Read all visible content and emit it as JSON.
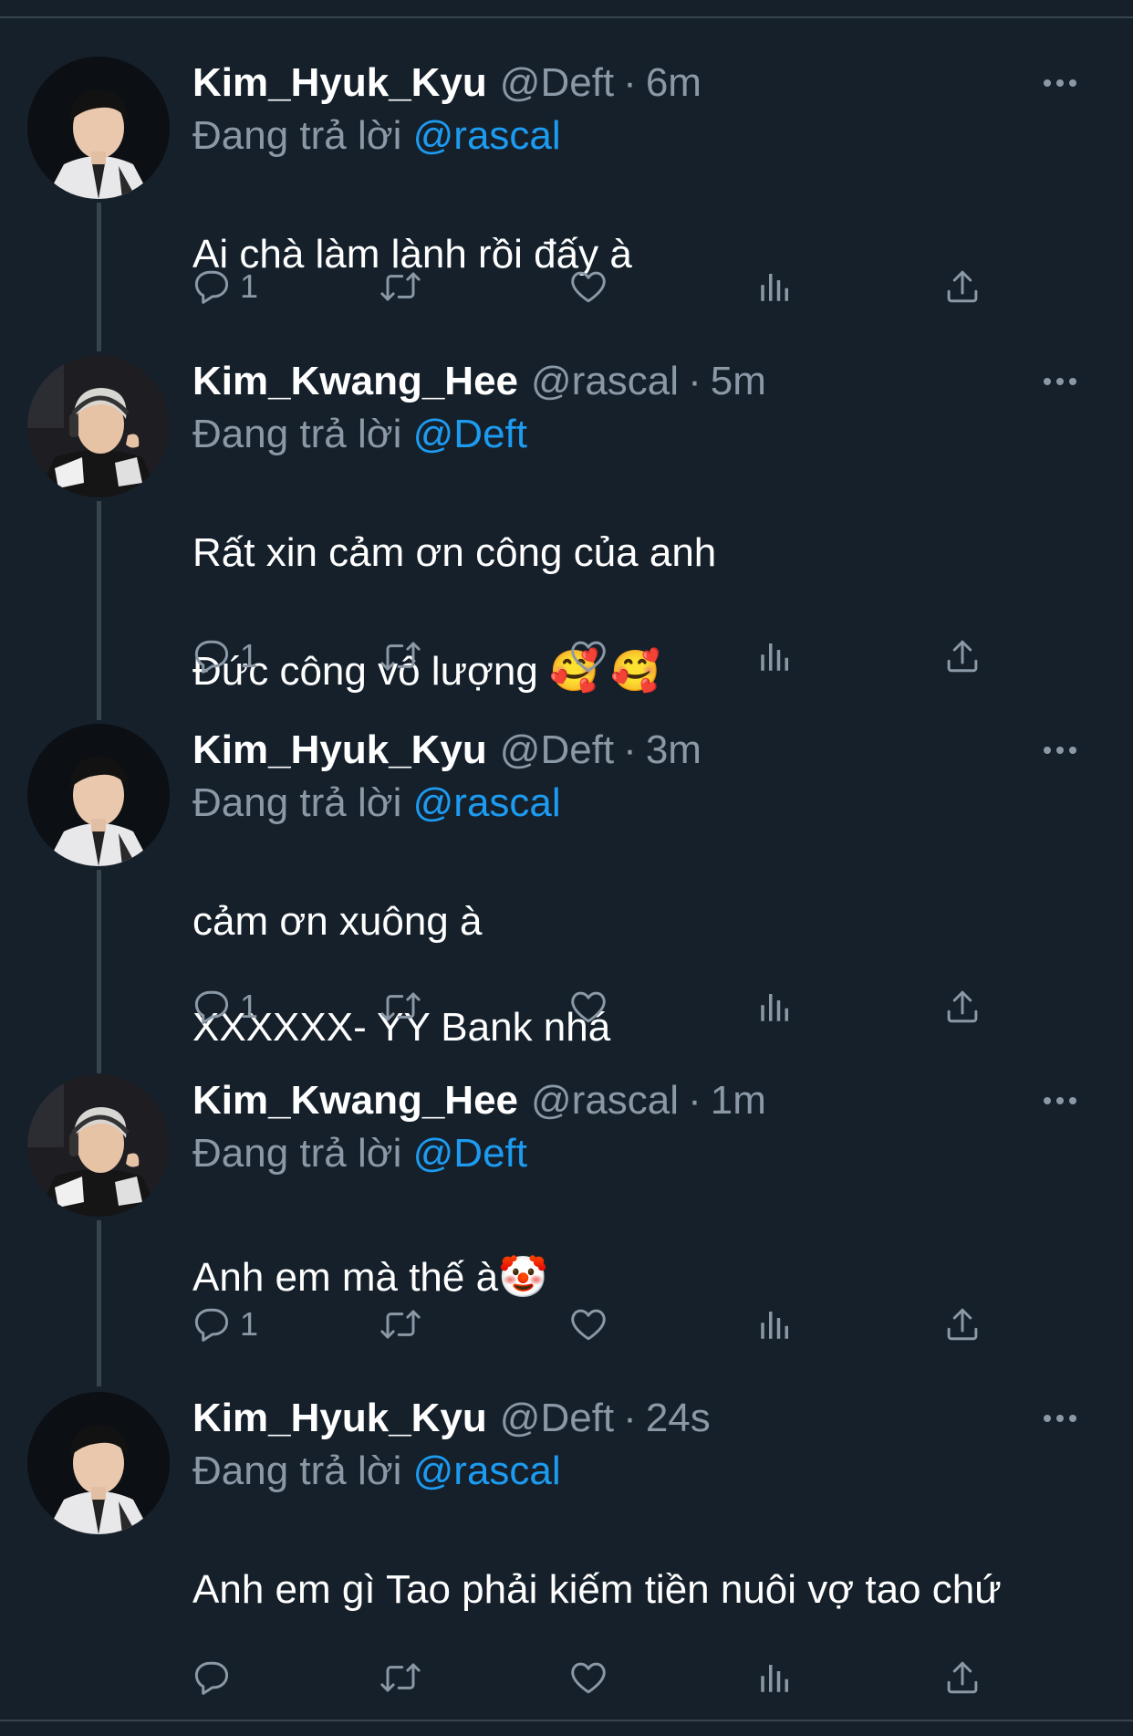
{
  "tweets": [
    {
      "name": "Kim_Hyuk_Kyu",
      "handle": "@Deft",
      "time": "6m",
      "reply_prefix": "Đang trả lời",
      "reply_to": "@rascal",
      "lines": [
        "Ai chà làm lành rồi đấy à"
      ],
      "reply_count": "1",
      "avatar": "avatar-deft"
    },
    {
      "name": "Kim_Kwang_Hee",
      "handle": "@rascal",
      "time": "5m",
      "reply_prefix": "Đang trả lời",
      "reply_to": "@Deft",
      "lines": [
        "Rất xin cảm ơn công của anh",
        "Đức công vô lượng 🥰 🥰"
      ],
      "reply_count": "1",
      "avatar": "avatar-rascal"
    },
    {
      "name": "Kim_Hyuk_Kyu",
      "handle": "@Deft",
      "time": "3m",
      "reply_prefix": "Đang trả lời",
      "reply_to": "@rascal",
      "lines": [
        "cảm ơn xuông à",
        "XXXXXX- YY Bank nhá"
      ],
      "reply_count": "1",
      "avatar": "avatar-deft"
    },
    {
      "name": "Kim_Kwang_Hee",
      "handle": "@rascal",
      "time": "1m",
      "reply_prefix": "Đang trả lời",
      "reply_to": "@Deft",
      "lines": [
        "Anh em mà thế à🤡"
      ],
      "reply_count": "1",
      "avatar": "avatar-rascal"
    },
    {
      "name": "Kim_Hyuk_Kyu",
      "handle": "@Deft",
      "time": "24s",
      "reply_prefix": "Đang trả lời",
      "reply_to": "@rascal",
      "lines": [
        "Anh em gì Tao phải kiếm tiền nuôi  vợ tao chứ"
      ],
      "reply_count": "",
      "avatar": "avatar-deft"
    }
  ],
  "colors": {
    "background": "#15202b",
    "muted": "#8b98a5",
    "mention": "#1d9bf0",
    "divider": "#38444d"
  },
  "icons": [
    "reply-icon",
    "retweet-icon",
    "like-icon",
    "analytics-icon",
    "share-icon",
    "more-icon"
  ]
}
